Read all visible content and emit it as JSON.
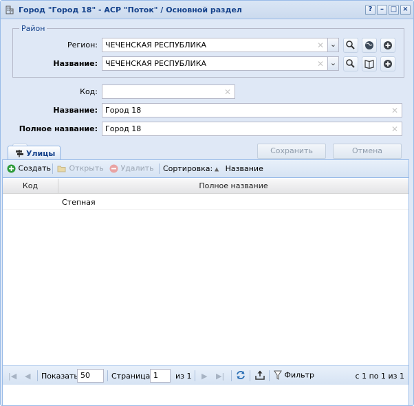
{
  "window": {
    "title": "Город \"Город 18\" - АСР \"Поток\" / Основной раздел",
    "tools": {
      "help": "?",
      "minimize": "–",
      "maximize": "□",
      "close": "×"
    }
  },
  "district": {
    "legend": "Район",
    "region_label": "Регион:",
    "region_value": "ЧЕЧЕНСКАЯ РЕСПУБЛИКА",
    "name_label": "Название:",
    "name_value": "ЧЕЧЕНСКАЯ РЕСПУБЛИКА"
  },
  "form": {
    "code_label": "Код:",
    "code_value": "",
    "name_label": "Название:",
    "name_value": "Город 18",
    "fullname_label": "Полное название:",
    "fullname_value": "Город 18",
    "save_label": "Сохранить",
    "cancel_label": "Отмена"
  },
  "tab": {
    "label": "Улицы"
  },
  "toolbar": {
    "create_label": "Создать",
    "open_label": "Открыть",
    "delete_label": "Удалить",
    "sort_label": "Сортировка:",
    "sort_field": "Название"
  },
  "grid": {
    "columns": [
      "Код",
      "Полное название"
    ],
    "rows": [
      {
        "code": "",
        "fullname": "Степная"
      }
    ]
  },
  "pager": {
    "show_label": "Показать",
    "page_size": "50",
    "page_label": "Страница",
    "page_value": "1",
    "of_label": "из 1",
    "filter_label": "Фильтр",
    "summary": "с 1 по 1 из 1"
  },
  "colors": {
    "title": "#15428b",
    "frame": "#99bbe8",
    "panel_bg": "#dfe8f6",
    "add_green": "#2e9b3a"
  }
}
